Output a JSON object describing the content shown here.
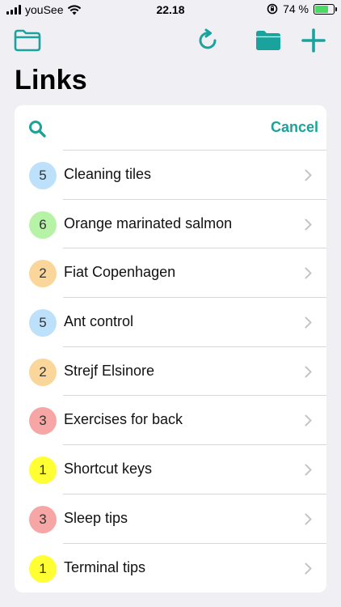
{
  "status_bar": {
    "carrier": "youSee",
    "time": "22.18",
    "battery": "74 %",
    "battery_level": 0.74
  },
  "toolbar": {
    "accent_color": "#1aa39c"
  },
  "page": {
    "title": "Links"
  },
  "search": {
    "placeholder": "",
    "value": "",
    "cancel_label": "Cancel"
  },
  "badge_colors": {
    "blue": "#bde0fb",
    "green": "#b7f3a7",
    "orange": "#fbd69a",
    "red": "#f7a6a6",
    "yellow": "#ffff33"
  },
  "links": [
    {
      "count": "5",
      "label": "Cleaning tiles",
      "color": "#bde0fb"
    },
    {
      "count": "6",
      "label": "Orange marinated salmon",
      "color": "#b7f3a7"
    },
    {
      "count": "2",
      "label": "Fiat Copenhagen",
      "color": "#fbd69a"
    },
    {
      "count": "5",
      "label": "Ant control",
      "color": "#bde0fb"
    },
    {
      "count": "2",
      "label": "Strejf Elsinore",
      "color": "#fbd69a"
    },
    {
      "count": "3",
      "label": "Exercises for back",
      "color": "#f7a6a6"
    },
    {
      "count": "1",
      "label": "Shortcut keys",
      "color": "#ffff33"
    },
    {
      "count": "3",
      "label": "Sleep tips",
      "color": "#f7a6a6"
    },
    {
      "count": "1",
      "label": "Terminal tips",
      "color": "#ffff33"
    }
  ]
}
